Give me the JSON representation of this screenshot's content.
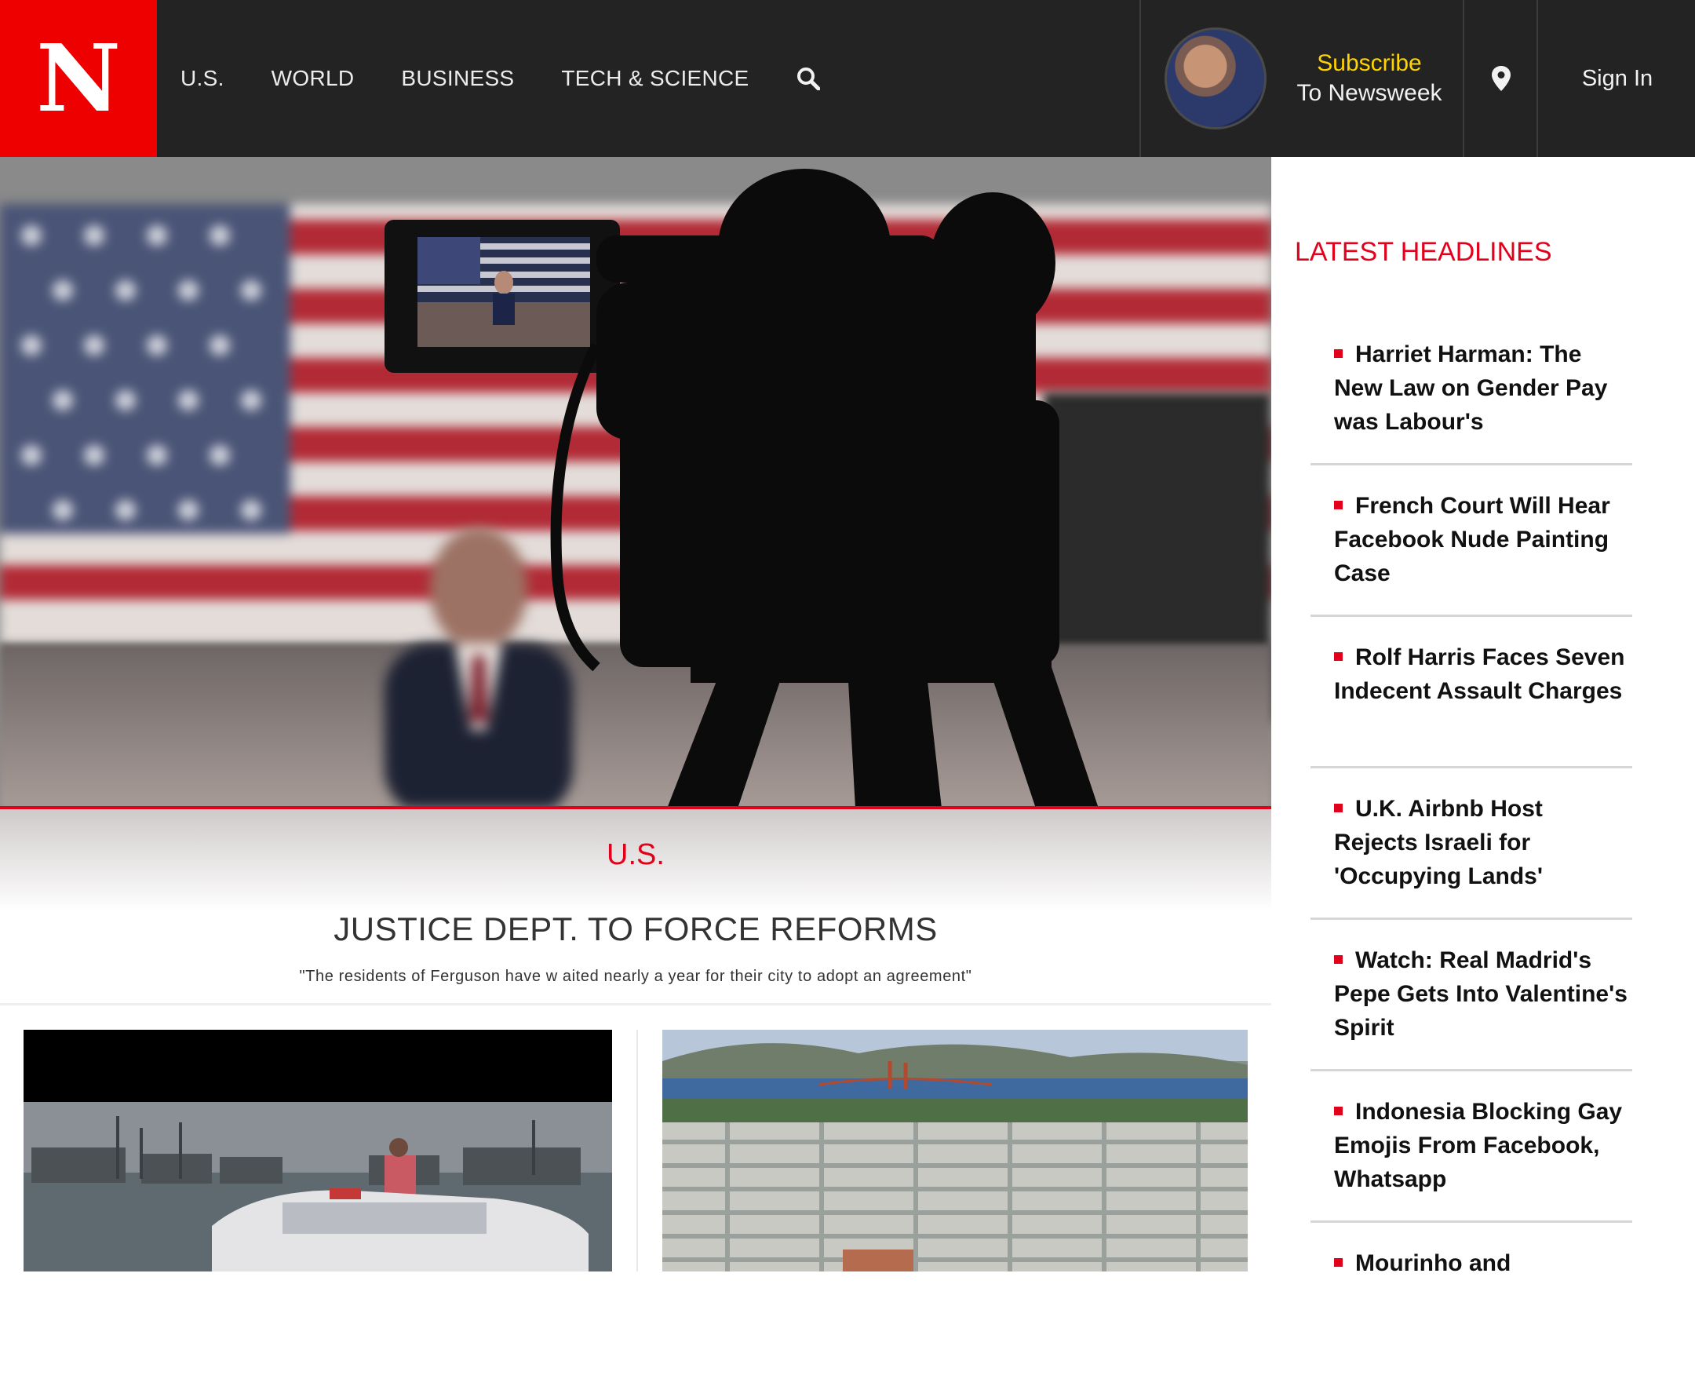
{
  "header": {
    "logo": "N",
    "nav": [
      "U.S.",
      "WORLD",
      "BUSINESS",
      "TECH & SCIENCE"
    ],
    "search_icon": "search-icon",
    "subscribe_line1": "Subscribe",
    "subscribe_line2": "To Newsweek",
    "location_icon": "map-pin-icon",
    "signin": "Sign In"
  },
  "hero": {
    "category": "U.S.",
    "headline": "JUSTICE DEPT. TO FORCE REFORMS",
    "dek": "\"The residents of Ferguson have w aited nearly a year for their city to adopt an agreement\""
  },
  "sidebar": {
    "title": "LATEST HEADLINES",
    "items": [
      "Harriet Harman: The New Law on Gender Pay was Labour's",
      "French Court Will Hear Facebook Nude Painting Case",
      "Rolf Harris Faces Seven Indecent Assault Charges",
      "U.K. Airbnb Host Rejects Israeli for 'Occupying Lands'",
      "Watch: Real Madrid's Pepe Gets Into Valentine's Spirit",
      "Indonesia Blocking Gay Emojis From Facebook, Whatsapp",
      "Mourinho and"
    ]
  },
  "colors": {
    "brand_red": "#ee0000",
    "accent_red": "#e3001b",
    "header_bg": "#232323",
    "subscribe_yellow": "#ffd400"
  }
}
